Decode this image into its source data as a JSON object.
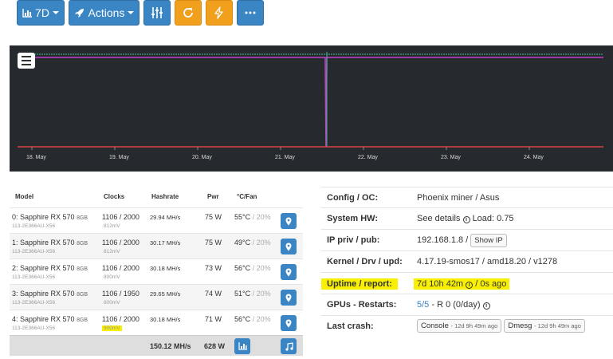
{
  "toolbar": {
    "range_label": "7D",
    "actions_label": "Actions"
  },
  "chart_data": {
    "type": "line",
    "x_ticks": [
      "18. May",
      "19. May",
      "20. May",
      "21. May",
      "22. May",
      "23. May",
      "24. May"
    ],
    "series": [
      {
        "color": "#c040c8",
        "values": "flat hashrate level with a single drop to zero on 21. May"
      },
      {
        "color": "#e04040",
        "values": "flat near zero"
      }
    ],
    "colors": {
      "background": "#26292e",
      "purple": "#c040c8",
      "green": "#3fb98c",
      "red": "#d84444"
    }
  },
  "gpu_table": {
    "headers": {
      "model": "Model",
      "clocks": "Clocks",
      "hashrate": "Hashrate",
      "pwr": "Pwr",
      "temp": "°C/Fan"
    },
    "rows": [
      {
        "name": "0: Sapphire RX 570",
        "mem": "8GB",
        "vbios": "113-2E366AU-X56",
        "clocks": "1106 / 2000",
        "volt": "812mV",
        "hash": "29.94 MH/s",
        "pwr": "75 W",
        "temp": "55°C",
        "fan": " / 20%"
      },
      {
        "name": "1: Sapphire RX 570",
        "mem": "8GB",
        "vbios": "113-2E366AU-X56",
        "clocks": "1106 / 2000",
        "volt": "812mV",
        "hash": "30.17 MH/s",
        "pwr": "75 W",
        "temp": "49°C",
        "fan": " / 20%"
      },
      {
        "name": "2: Sapphire RX 570",
        "mem": "8GB",
        "vbios": "113-2E366AU-X56",
        "clocks": "1106 / 2000",
        "volt": "800mV",
        "hash": "30.18 MH/s",
        "pwr": "73 W",
        "temp": "56°C",
        "fan": " / 20%"
      },
      {
        "name": "3: Sapphire RX 570",
        "mem": "8GB",
        "vbios": "113-2E366AU-X56",
        "clocks": "1106 / 1950",
        "volt": "800mV",
        "hash": "29.65 MH/s",
        "pwr": "74 W",
        "temp": "51°C",
        "fan": " / 20%"
      },
      {
        "name": "4: Sapphire RX 570",
        "mem": "8GB",
        "vbios": "113-2E366AU-X56",
        "clocks": "1106 / 2000",
        "volt": "800mV",
        "hash": "30.18 MH/s",
        "pwr": "71 W",
        "temp": "56°C",
        "fan": " / 20%"
      }
    ],
    "total_hash": "150.12 MH/s",
    "total_pwr": "628 W"
  },
  "info": {
    "config_label": "Config / OC:",
    "config_value": "Phoenix miner / Asus",
    "system_label": "System HW:",
    "system_value": "See details",
    "system_load": "Load: 0.75",
    "ip_label": "IP priv / pub:",
    "ip_value": "192.168.1.8 /",
    "show_ip": "Show IP",
    "kernel_label": "Kernel / Drv / upd:",
    "kernel_value": "4.17.19-smos17 / amd18.20 / v1278",
    "uptime_label": "Uptime / report:",
    "uptime_value": "7d 10h 42m",
    "uptime_ago": "/ 0s ago",
    "gpus_label": "GPUs - Restarts:",
    "gpus_value": "5/5",
    "restarts_value": "- R 0 (0/day)",
    "crash_label": "Last crash:",
    "console_label": "Console",
    "console_ago": "- 12d 9h 49m ago",
    "dmesg_label": "Dmesg",
    "dmesg_ago": "- 12d 9h 49m ago"
  }
}
